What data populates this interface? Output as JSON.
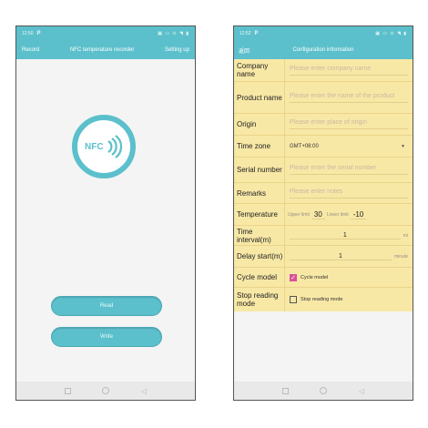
{
  "status": {
    "time": "12:50",
    "p_icon": "P",
    "right_icons": "▣ ▭ ⊙ ◥ ▮"
  },
  "status2": {
    "time": "12:52",
    "p_icon": "P",
    "right_icons": "▣ ▭ ⊙ ◥ ▮"
  },
  "screen1": {
    "left": "Record",
    "title": "NFC temperature recorder",
    "right": "Setting up",
    "logo_text": "NFC",
    "read": "Read",
    "write": "Write"
  },
  "screen2": {
    "back": "返回",
    "title": "Configuration information",
    "company": {
      "label": "Company name",
      "placeholder": "Please enter company name"
    },
    "product": {
      "label": "Product name",
      "placeholder": "Please enter the name of the product"
    },
    "origin": {
      "label": "Origin",
      "placeholder": "Please enter place of origin"
    },
    "timezone": {
      "label": "Time zone",
      "value": "GMT+08:00"
    },
    "serial": {
      "label": "Serial number",
      "placeholder": "Please enter the serial number"
    },
    "remarks": {
      "label": "Remarks",
      "placeholder": "Please enter notes"
    },
    "temperature": {
      "label": "Temperature",
      "upper_label": "Upper limit",
      "upper": "30",
      "lower_label": "Lower limit",
      "lower": "-10"
    },
    "interval": {
      "label": "Time interval(m)",
      "value": "1",
      "unit": "mi"
    },
    "delay": {
      "label": "Delay start(m)",
      "value": "1",
      "unit": "minute"
    },
    "cycle": {
      "label": "Cycle model",
      "option": "Cycle model",
      "checked": true
    },
    "stop": {
      "label": "Stop reading mode",
      "option": "Stop reading mode",
      "checked": false
    }
  },
  "colors": {
    "accent": "#5cc0cc",
    "form_bg": "#f8e8a6",
    "checkbox": "#d9509a"
  },
  "icons": [
    "nfc-logo-icon",
    "square-nav-icon",
    "circle-nav-icon",
    "back-triangle-icon",
    "dropdown-arrow-icon"
  ]
}
